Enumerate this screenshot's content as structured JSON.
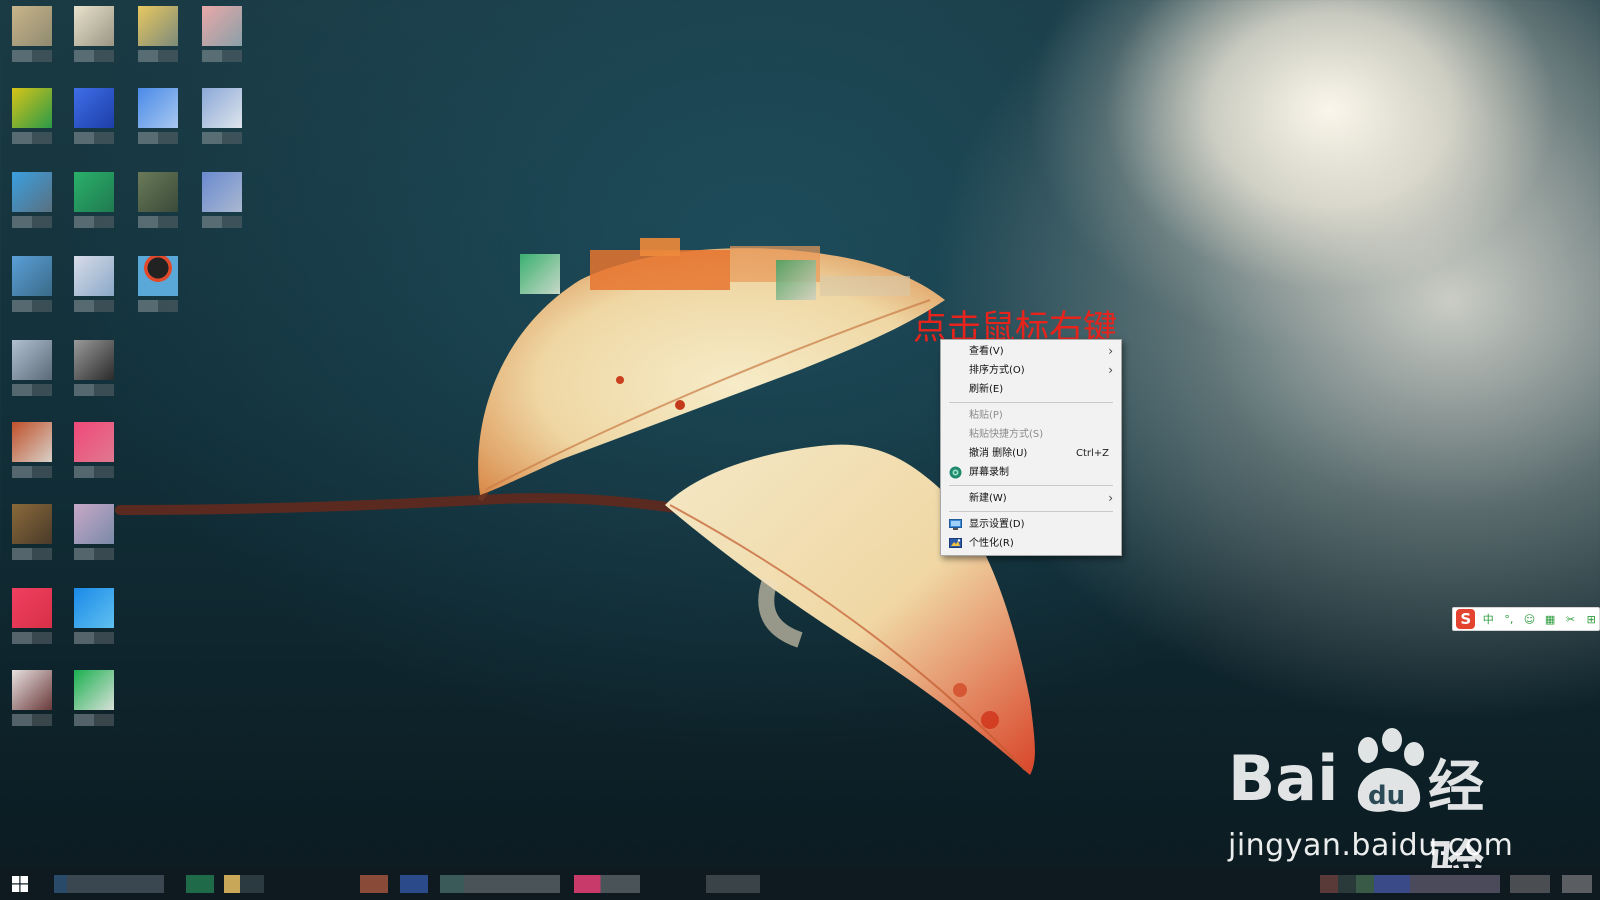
{
  "annotation": {
    "text": "点击鼠标右键",
    "color": "#e8231c"
  },
  "context_menu": {
    "items": [
      {
        "id": "view",
        "label": "查看(V)",
        "submenu": true,
        "disabled": false,
        "icon": null
      },
      {
        "id": "sort",
        "label": "排序方式(O)",
        "submenu": true,
        "disabled": false,
        "icon": null
      },
      {
        "id": "refresh",
        "label": "刷新(E)",
        "submenu": false,
        "disabled": false,
        "icon": null
      },
      {
        "id": "paste",
        "label": "粘贴(P)",
        "submenu": false,
        "disabled": true,
        "icon": null
      },
      {
        "id": "paste-shortcut",
        "label": "粘贴快捷方式(S)",
        "submenu": false,
        "disabled": true,
        "icon": null
      },
      {
        "id": "undo-delete",
        "label": "撤消 删除(U)",
        "shortcut": "Ctrl+Z",
        "submenu": false,
        "disabled": false,
        "icon": null
      },
      {
        "id": "screen-record",
        "label": "屏幕录制",
        "submenu": false,
        "disabled": false,
        "icon": "screen-record-icon"
      },
      {
        "id": "new",
        "label": "新建(W)",
        "submenu": true,
        "disabled": false,
        "icon": null
      },
      {
        "id": "display-settings",
        "label": "显示设置(D)",
        "submenu": false,
        "disabled": false,
        "icon": "display-icon"
      },
      {
        "id": "personalize",
        "label": "个性化(R)",
        "submenu": false,
        "disabled": false,
        "icon": "personalize-icon"
      }
    ],
    "chevron": "›"
  },
  "ime_toolbar": {
    "logo": "S",
    "mode": "中",
    "buttons": [
      "°,",
      "☺",
      "▦",
      "✂",
      "⊞"
    ]
  },
  "watermark": {
    "brand_left": "Bai",
    "brand_right": "经验",
    "url": "jingyan.baidu.com"
  },
  "colors": {
    "menu_background": "#f2f2f2",
    "annotation": "#e8231c",
    "taskbar": "#0e1a20"
  }
}
